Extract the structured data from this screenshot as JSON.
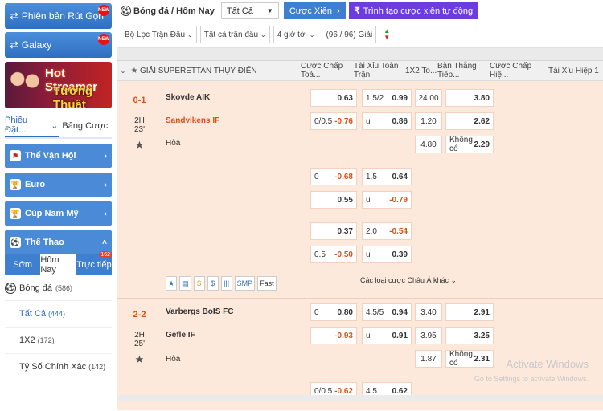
{
  "sidebar": {
    "promo1": "Phiên bản Rút Gọn",
    "promo2": "Galaxy",
    "badge_new": "NEW",
    "banner_line1": "Hot Streamer",
    "banner_line2": "Tường Thuật",
    "tabs": [
      "Phiếu Đặt...",
      "Bảng Cược"
    ],
    "categories": [
      "Thể Vận Hội",
      "Euro",
      "Cúp Nam Mỹ",
      "Thể Thao"
    ],
    "subtabs": [
      "Sớm",
      "Hôm Nay",
      "Trực tiếp"
    ],
    "live_count": "162",
    "sport_label": "Bóng đá",
    "sport_count": "(586)",
    "items": [
      {
        "label": "Tất Cả",
        "count": "(444)"
      },
      {
        "label": "1X2",
        "count": "(172)"
      },
      {
        "label": "Tỷ Số Chính Xác",
        "count": "(142)"
      }
    ]
  },
  "topbar": {
    "sport": "Bóng đá / Hôm Nay",
    "select": "Tất Cả",
    "cuoc_xien": "Cược Xiên",
    "builder": "Trình tạo cược xiên tự động"
  },
  "filters": [
    "Bộ Lọc Trận Đấu",
    "Tất cả trận đấu",
    "4 giờ tới",
    "(96 / 96) Giải"
  ],
  "columns": [
    "GIẢI SUPERETTAN THỤY ĐIỂN",
    "Cược Chấp Toà...",
    "Tài Xỉu Toàn Trận",
    "1X2 To...",
    "Bàn Thắng Tiếp...",
    "Cược Chấp Hiệ...",
    "Tài Xỉu Hiệp 1"
  ],
  "match1": {
    "score": "0-1",
    "half": "2H",
    "minute": "23'",
    "home": "Skovde AIK",
    "away": "Sandvikens IF",
    "draw": "Hòa",
    "rows": [
      {
        "hc_line": "",
        "hc_val": "0.63",
        "ou_line": "1.5/2",
        "ou_val": "0.99",
        "x12": "24.00",
        "next": "",
        "next_val": "3.80"
      },
      {
        "hc_line": "0/0.5",
        "hc_val": "-0.76",
        "ou_line": "u",
        "ou_val": "0.86",
        "x12": "1.20",
        "next": "",
        "next_val": "2.62"
      },
      {
        "x12": "4.80",
        "next": "Không có",
        "next_val": "2.29"
      }
    ],
    "alt": [
      {
        "hc_line": "0",
        "hc_val": "-0.68",
        "ou_line": "1.5",
        "ou_val": "0.64"
      },
      {
        "hc_line": "",
        "hc_val": "0.55",
        "ou_line": "u",
        "ou_val": "-0.79"
      },
      {
        "hc_line": "",
        "hc_val": "0.37",
        "ou_line": "2.0",
        "ou_val": "-0.54"
      },
      {
        "hc_line": "0.5",
        "hc_val": "-0.50",
        "ou_line": "u",
        "ou_val": "0.39"
      }
    ],
    "icons": [
      "★",
      "▤",
      "$",
      "$",
      "|||",
      "SMP",
      "Fast"
    ],
    "more": "Các loại cược Châu Á khác"
  },
  "match2": {
    "score": "2-2",
    "half": "2H",
    "minute": "25'",
    "home": "Varbergs BoIS FC",
    "away": "Gefle IF",
    "draw": "Hòa",
    "rows": [
      {
        "hc_line": "0",
        "hc_val": "0.80",
        "ou_line": "4.5/5",
        "ou_val": "0.94",
        "x12": "3.40",
        "next": "",
        "next_val": "2.91"
      },
      {
        "hc_line": "",
        "hc_val": "-0.93",
        "ou_line": "u",
        "ou_val": "0.91",
        "x12": "3.95",
        "next": "",
        "next_val": "3.25"
      },
      {
        "x12": "1.87",
        "next": "Không có",
        "next_val": "2.31"
      }
    ],
    "alt": [
      {
        "hc_line": "0/0.5",
        "hc_val": "-0.62",
        "ou_line": "4.5",
        "ou_val": "0.62"
      }
    ]
  },
  "watermark": {
    "title": "Activate Windows",
    "sub": "Go to Settings to activate Windows."
  },
  "colors": {
    "accent": "#3f7fcf",
    "purple": "#6c3ce0",
    "orange": "#d6521a",
    "rowbg": "#fde9dc"
  }
}
